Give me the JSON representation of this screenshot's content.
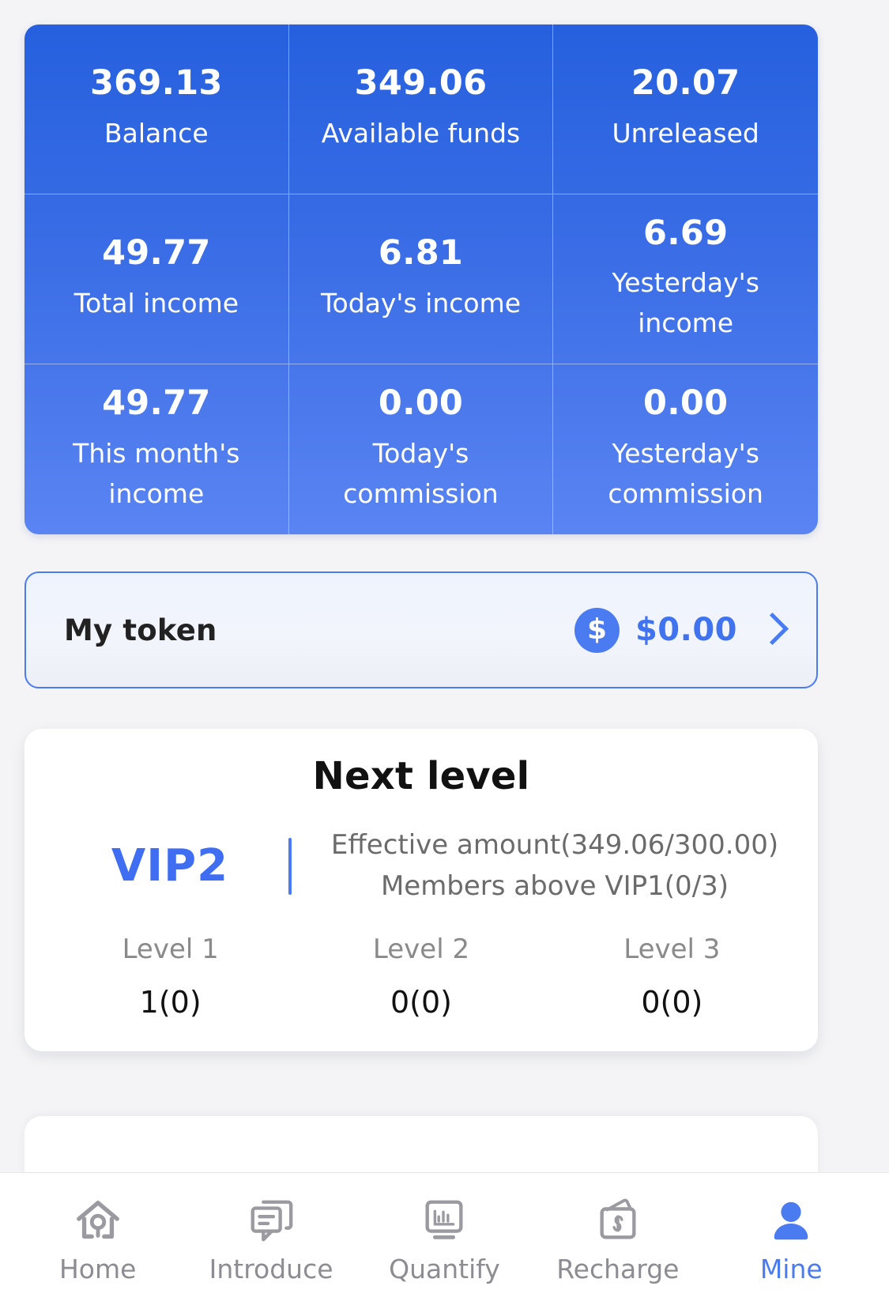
{
  "stats": {
    "cells": [
      {
        "value": "369.13",
        "label": "Balance"
      },
      {
        "value": "349.06",
        "label": "Available funds"
      },
      {
        "value": "20.07",
        "label": "Unreleased"
      },
      {
        "value": "49.77",
        "label": "Total income"
      },
      {
        "value": "6.81",
        "label": "Today's income"
      },
      {
        "value": "6.69",
        "label": "Yesterday's income"
      },
      {
        "value": "49.77",
        "label": "This month's income"
      },
      {
        "value": "0.00",
        "label": "Today's commission"
      },
      {
        "value": "0.00",
        "label": "Yesterday's commission"
      }
    ]
  },
  "token": {
    "label": "My token",
    "badge_symbol": "$",
    "amount": "$0.00",
    "chevron_icon": "chevron-right-icon"
  },
  "next_level": {
    "title": "Next level",
    "vip": "VIP2",
    "requirement_effective": "Effective amount(349.06/300.00)",
    "requirement_members": "Members above VIP1(0/3)",
    "levels": [
      {
        "name": "Level 1",
        "count": "1(0)"
      },
      {
        "name": "Level 2",
        "count": "0(0)"
      },
      {
        "name": "Level 3",
        "count": "0(0)"
      }
    ]
  },
  "bottom_nav": {
    "items": [
      {
        "label": "Home",
        "icon": "home-icon",
        "active": false
      },
      {
        "label": "Introduce",
        "icon": "chat-icon",
        "active": false
      },
      {
        "label": "Quantify",
        "icon": "monitor-chart-icon",
        "active": false
      },
      {
        "label": "Recharge",
        "icon": "wallet-icon",
        "active": false
      },
      {
        "label": "Mine",
        "icon": "person-icon",
        "active": true
      }
    ]
  },
  "colors": {
    "accent": "#4a7bf0",
    "stat_gradient_top": "#2660de",
    "stat_gradient_bottom": "#5a84f2",
    "nav_inactive": "#8c8c92",
    "page_bg": "#f4f4f6"
  }
}
